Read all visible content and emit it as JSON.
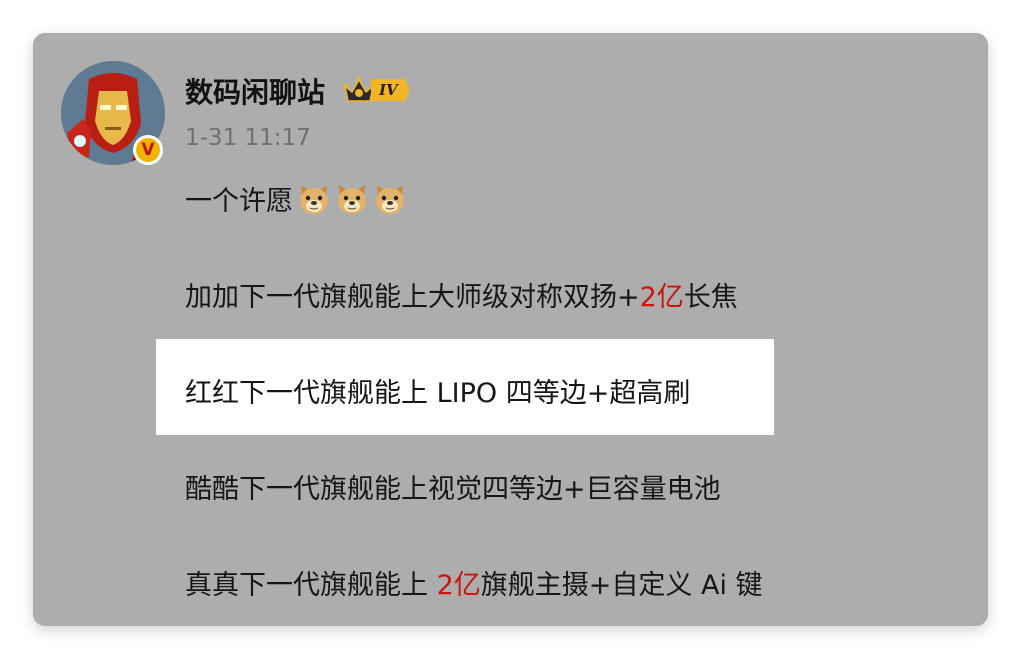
{
  "user": {
    "name": "数码闲聊站",
    "level": "IV",
    "verified": "V",
    "timestamp": "1-31 11:17"
  },
  "post": {
    "line1": {
      "text": "一个许愿",
      "emojis": [
        "doge-icon",
        "doge-icon",
        "doge-icon"
      ]
    },
    "line2": {
      "pre": "加加下一代旗舰能上大师级对称双扬+",
      "red": "2亿",
      "post": "长焦"
    },
    "line3": {
      "text": "红红下一代旗舰能上 LIPO 四等边+超高刷"
    },
    "line4": {
      "text": "酷酷下一代旗舰能上视觉四等边+巨容量电池"
    },
    "line5": {
      "pre": "真真下一代旗舰能上 ",
      "red": "2亿",
      "post": "旗舰主摄+自定义 Ai 键"
    }
  },
  "colors": {
    "card_background": "#adadad",
    "highlight": "#ffffff",
    "accent_red": "#c8160e",
    "badge_gold": "#f2b624"
  }
}
